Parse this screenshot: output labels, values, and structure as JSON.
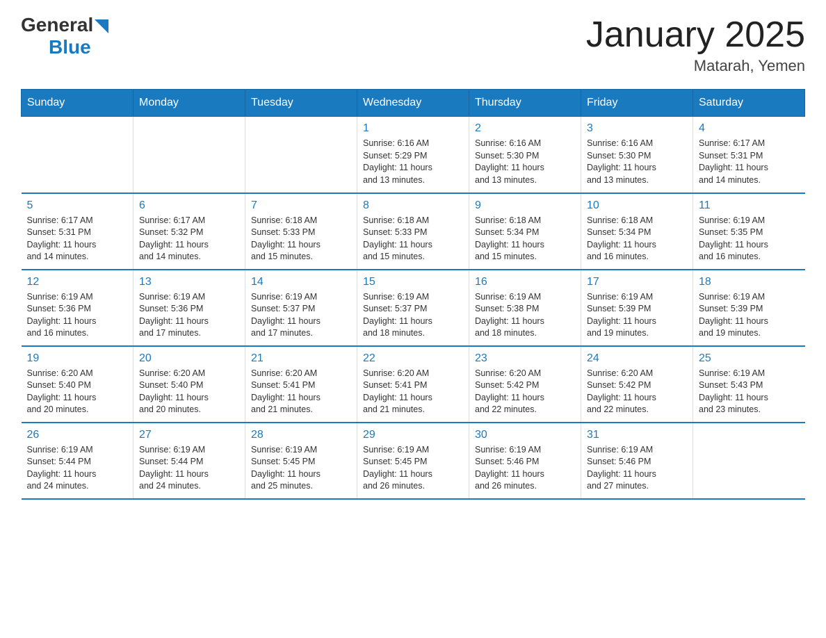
{
  "logo": {
    "general": "General",
    "blue": "Blue",
    "arrow": "▼"
  },
  "header": {
    "title": "January 2025",
    "location": "Matarah, Yemen"
  },
  "weekdays": [
    "Sunday",
    "Monday",
    "Tuesday",
    "Wednesday",
    "Thursday",
    "Friday",
    "Saturday"
  ],
  "weeks": [
    [
      {
        "day": "",
        "info": ""
      },
      {
        "day": "",
        "info": ""
      },
      {
        "day": "",
        "info": ""
      },
      {
        "day": "1",
        "info": "Sunrise: 6:16 AM\nSunset: 5:29 PM\nDaylight: 11 hours\nand 13 minutes."
      },
      {
        "day": "2",
        "info": "Sunrise: 6:16 AM\nSunset: 5:30 PM\nDaylight: 11 hours\nand 13 minutes."
      },
      {
        "day": "3",
        "info": "Sunrise: 6:16 AM\nSunset: 5:30 PM\nDaylight: 11 hours\nand 13 minutes."
      },
      {
        "day": "4",
        "info": "Sunrise: 6:17 AM\nSunset: 5:31 PM\nDaylight: 11 hours\nand 14 minutes."
      }
    ],
    [
      {
        "day": "5",
        "info": "Sunrise: 6:17 AM\nSunset: 5:31 PM\nDaylight: 11 hours\nand 14 minutes."
      },
      {
        "day": "6",
        "info": "Sunrise: 6:17 AM\nSunset: 5:32 PM\nDaylight: 11 hours\nand 14 minutes."
      },
      {
        "day": "7",
        "info": "Sunrise: 6:18 AM\nSunset: 5:33 PM\nDaylight: 11 hours\nand 15 minutes."
      },
      {
        "day": "8",
        "info": "Sunrise: 6:18 AM\nSunset: 5:33 PM\nDaylight: 11 hours\nand 15 minutes."
      },
      {
        "day": "9",
        "info": "Sunrise: 6:18 AM\nSunset: 5:34 PM\nDaylight: 11 hours\nand 15 minutes."
      },
      {
        "day": "10",
        "info": "Sunrise: 6:18 AM\nSunset: 5:34 PM\nDaylight: 11 hours\nand 16 minutes."
      },
      {
        "day": "11",
        "info": "Sunrise: 6:19 AM\nSunset: 5:35 PM\nDaylight: 11 hours\nand 16 minutes."
      }
    ],
    [
      {
        "day": "12",
        "info": "Sunrise: 6:19 AM\nSunset: 5:36 PM\nDaylight: 11 hours\nand 16 minutes."
      },
      {
        "day": "13",
        "info": "Sunrise: 6:19 AM\nSunset: 5:36 PM\nDaylight: 11 hours\nand 17 minutes."
      },
      {
        "day": "14",
        "info": "Sunrise: 6:19 AM\nSunset: 5:37 PM\nDaylight: 11 hours\nand 17 minutes."
      },
      {
        "day": "15",
        "info": "Sunrise: 6:19 AM\nSunset: 5:37 PM\nDaylight: 11 hours\nand 18 minutes."
      },
      {
        "day": "16",
        "info": "Sunrise: 6:19 AM\nSunset: 5:38 PM\nDaylight: 11 hours\nand 18 minutes."
      },
      {
        "day": "17",
        "info": "Sunrise: 6:19 AM\nSunset: 5:39 PM\nDaylight: 11 hours\nand 19 minutes."
      },
      {
        "day": "18",
        "info": "Sunrise: 6:19 AM\nSunset: 5:39 PM\nDaylight: 11 hours\nand 19 minutes."
      }
    ],
    [
      {
        "day": "19",
        "info": "Sunrise: 6:20 AM\nSunset: 5:40 PM\nDaylight: 11 hours\nand 20 minutes."
      },
      {
        "day": "20",
        "info": "Sunrise: 6:20 AM\nSunset: 5:40 PM\nDaylight: 11 hours\nand 20 minutes."
      },
      {
        "day": "21",
        "info": "Sunrise: 6:20 AM\nSunset: 5:41 PM\nDaylight: 11 hours\nand 21 minutes."
      },
      {
        "day": "22",
        "info": "Sunrise: 6:20 AM\nSunset: 5:41 PM\nDaylight: 11 hours\nand 21 minutes."
      },
      {
        "day": "23",
        "info": "Sunrise: 6:20 AM\nSunset: 5:42 PM\nDaylight: 11 hours\nand 22 minutes."
      },
      {
        "day": "24",
        "info": "Sunrise: 6:20 AM\nSunset: 5:42 PM\nDaylight: 11 hours\nand 22 minutes."
      },
      {
        "day": "25",
        "info": "Sunrise: 6:19 AM\nSunset: 5:43 PM\nDaylight: 11 hours\nand 23 minutes."
      }
    ],
    [
      {
        "day": "26",
        "info": "Sunrise: 6:19 AM\nSunset: 5:44 PM\nDaylight: 11 hours\nand 24 minutes."
      },
      {
        "day": "27",
        "info": "Sunrise: 6:19 AM\nSunset: 5:44 PM\nDaylight: 11 hours\nand 24 minutes."
      },
      {
        "day": "28",
        "info": "Sunrise: 6:19 AM\nSunset: 5:45 PM\nDaylight: 11 hours\nand 25 minutes."
      },
      {
        "day": "29",
        "info": "Sunrise: 6:19 AM\nSunset: 5:45 PM\nDaylight: 11 hours\nand 26 minutes."
      },
      {
        "day": "30",
        "info": "Sunrise: 6:19 AM\nSunset: 5:46 PM\nDaylight: 11 hours\nand 26 minutes."
      },
      {
        "day": "31",
        "info": "Sunrise: 6:19 AM\nSunset: 5:46 PM\nDaylight: 11 hours\nand 27 minutes."
      },
      {
        "day": "",
        "info": ""
      }
    ]
  ]
}
